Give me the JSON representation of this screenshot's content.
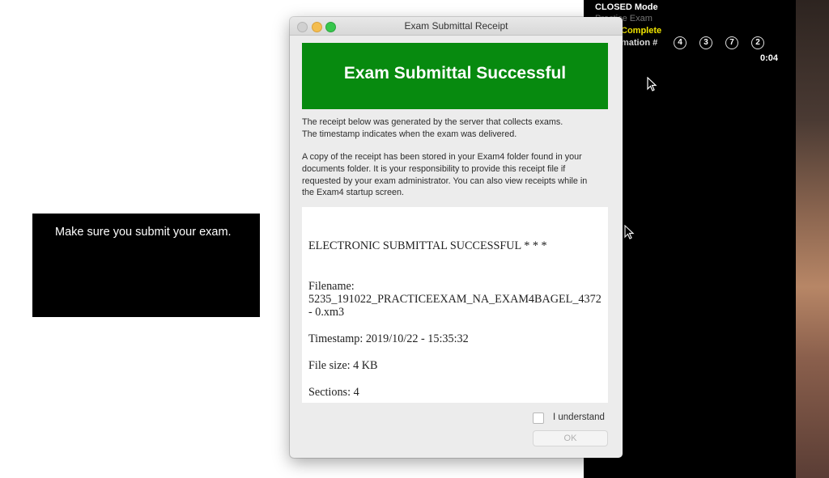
{
  "status_panel": {
    "mode": "CLOSED Mode",
    "exam_name": "Practice Exam",
    "status": "Complete",
    "confirmation_label": "mation #",
    "confirmation_digits": [
      "4",
      "3",
      "7",
      "2"
    ],
    "timer": "0:04"
  },
  "tooltip": {
    "text": "Make sure you submit your exam."
  },
  "window": {
    "title": "Exam Submittal Receipt",
    "banner": "Exam Submittal Successful",
    "banner_color": "#078a0f",
    "info_lines": [
      "The receipt below was generated by the server that collects exams.",
      "The timestamp indicates when the exam was delivered."
    ],
    "copy_lines": [
      "A copy of the receipt has been stored in your Exam4 folder found in your",
      "documents folder. It is your responsibility to provide this receipt file if",
      "requested by your exam administrator. You can also view receipts while in",
      "the Exam4 startup screen."
    ],
    "receipt": {
      "heading": "ELECTRONIC SUBMITTAL SUCCESSFUL * * *",
      "filename_label": "Filename:",
      "filename_line1": "5235_191022_PRACTICEEXAM_NA_EXAM4BAGEL_4372",
      "filename_line2": "- 0.xm3",
      "timestamp": "Timestamp: 2019/10/22 - 15:35:32",
      "file_size": "File size: 4 KB",
      "sections": "Sections: 4"
    },
    "checkbox_label": "I understand",
    "checkbox_checked": false,
    "ok_label": "OK"
  }
}
